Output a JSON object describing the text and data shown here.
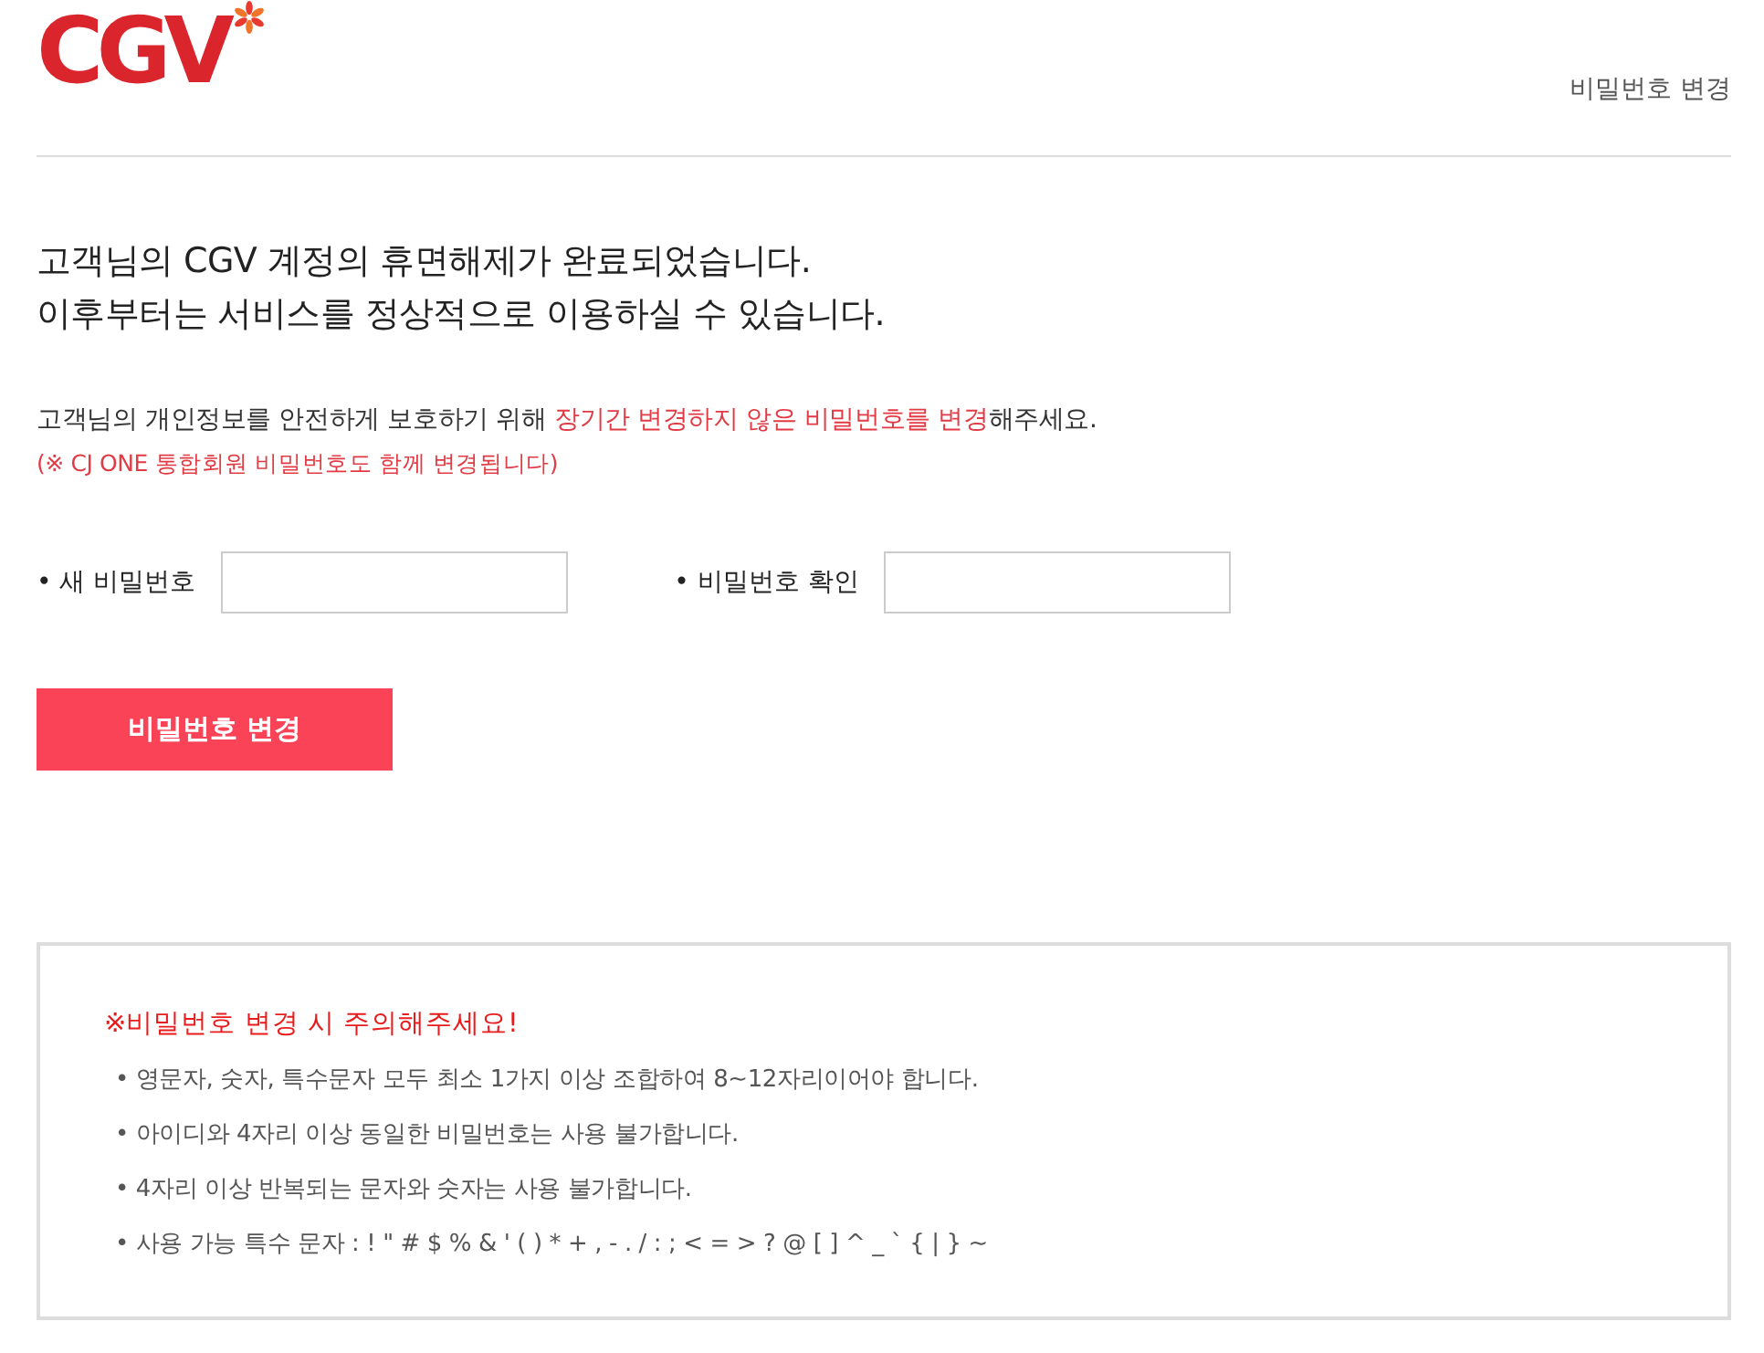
{
  "header": {
    "logo": "CGV",
    "title": "비밀번호 변경"
  },
  "headline": [
    "고객님의 CGV 계정의 휴면해제가 완료되었습니다.",
    "이후부터는 서비스를 정상적으로 이용하실 수 있습니다."
  ],
  "notice": {
    "parts": [
      {
        "text": "고객님의 개인정보를 안전하게 보호하기 위해 ",
        "highlight": false
      },
      {
        "text": "장기간 변경하지 않은 비밀번호를 변경",
        "highlight": true
      },
      {
        "text": "해주세요.",
        "highlight": false
      }
    ],
    "note": "(※ CJ ONE 통합회원 비밀번호도 함께 변경됩니다)"
  },
  "fields": [
    {
      "label": "• 새 비밀번호"
    },
    {
      "label": "• 비밀번호 확인"
    }
  ],
  "submit_button": "비밀번호 변경",
  "caution": {
    "title": "※비밀번호 변경 시 주의해주세요!",
    "rules": [
      "• 영문자, 숫자, 특수문자 모두 최소 1가지 이상 조합하여 8~12자리이어야 합니다.",
      "• 아이디와 4자리 이상 동일한 비밀번호는 사용 불가합니다.",
      "• 4자리 이상 반복되는 문자와 숫자는 사용 불가합니다.",
      "• 사용 가능 특수 문자 : ! \" # $ % & ' ( ) * + , - . / : ; < = > ? @ [ ] ^ _ ` { | } ~"
    ]
  }
}
